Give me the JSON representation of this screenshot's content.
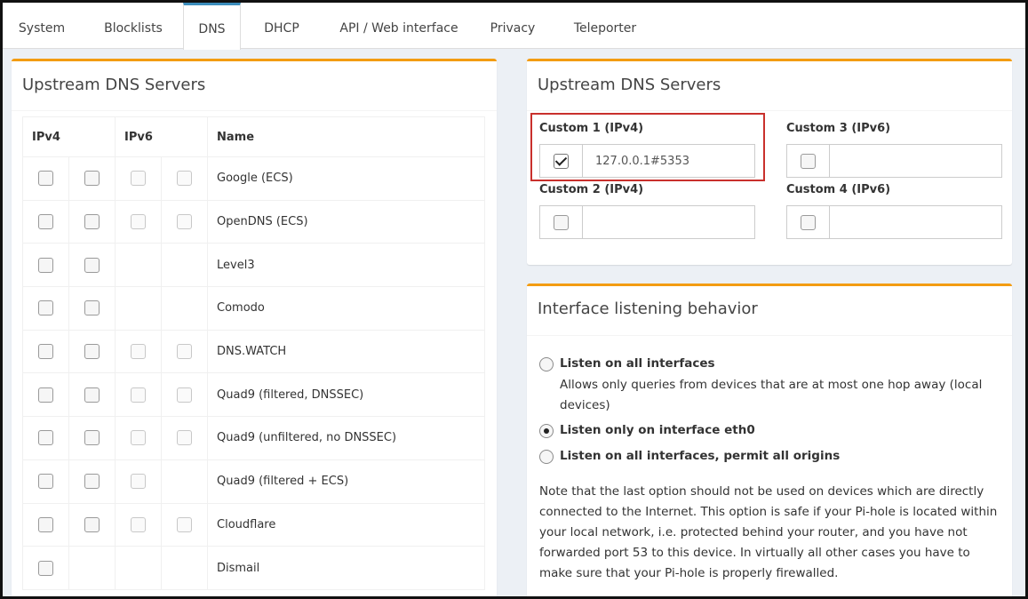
{
  "tabs": [
    {
      "label": "System"
    },
    {
      "label": "Blocklists"
    },
    {
      "label": "DNS",
      "active": true
    },
    {
      "label": "DHCP"
    },
    {
      "label": "API / Web interface"
    },
    {
      "label": "Privacy"
    },
    {
      "label": "Teleporter"
    }
  ],
  "left_panel": {
    "title": "Upstream DNS Servers",
    "headers": {
      "ipv4": "IPv4",
      "ipv6": "IPv6",
      "name": "Name"
    },
    "rows": [
      {
        "name": "Google (ECS)",
        "ipv4": 2,
        "ipv6": 2
      },
      {
        "name": "OpenDNS (ECS)",
        "ipv4": 2,
        "ipv6": 2
      },
      {
        "name": "Level3",
        "ipv4": 2,
        "ipv6": 0
      },
      {
        "name": "Comodo",
        "ipv4": 2,
        "ipv6": 0
      },
      {
        "name": "DNS.WATCH",
        "ipv4": 2,
        "ipv6": 2
      },
      {
        "name": "Quad9 (filtered, DNSSEC)",
        "ipv4": 2,
        "ipv6": 2
      },
      {
        "name": "Quad9 (unfiltered, no DNSSEC)",
        "ipv4": 2,
        "ipv6": 2
      },
      {
        "name": "Quad9 (filtered + ECS)",
        "ipv4": 2,
        "ipv6": 1
      },
      {
        "name": "Cloudflare",
        "ipv4": 2,
        "ipv6": 2
      },
      {
        "name": "Dismail",
        "ipv4": 1,
        "ipv6": 0
      }
    ]
  },
  "right_panel": {
    "title": "Upstream DNS Servers",
    "custom1": {
      "label": "Custom 1 (IPv4)",
      "checked": true,
      "value": "127.0.0.1#5353"
    },
    "custom2": {
      "label": "Custom 2 (IPv4)",
      "checked": false,
      "value": ""
    },
    "custom3": {
      "label": "Custom 3 (IPv6)",
      "checked": false,
      "value": ""
    },
    "custom4": {
      "label": "Custom 4 (IPv6)",
      "checked": false,
      "value": ""
    }
  },
  "interface_panel": {
    "title": "Interface listening behavior",
    "options": [
      {
        "label": "Listen on all interfaces",
        "selected": false
      },
      {
        "label": "Listen only on interface eth0",
        "selected": true
      },
      {
        "label": "Listen on all interfaces, permit all origins",
        "selected": false
      }
    ],
    "option1_desc": "Allows only queries from devices that are at most one hop away (local devices)",
    "note": "Note that the last option should not be used on devices which are directly connected to the Internet. This option is safe if your Pi-hole is located within your local network, i.e. protected behind your router, and you have not forwarded port 53 to this device. In virtually all other cases you have to make sure that your Pi-hole is properly firewalled."
  },
  "colors": {
    "panel_accent": "#f39c12",
    "highlight": "#c9302c",
    "tab_accent": "#3c8dbc"
  }
}
